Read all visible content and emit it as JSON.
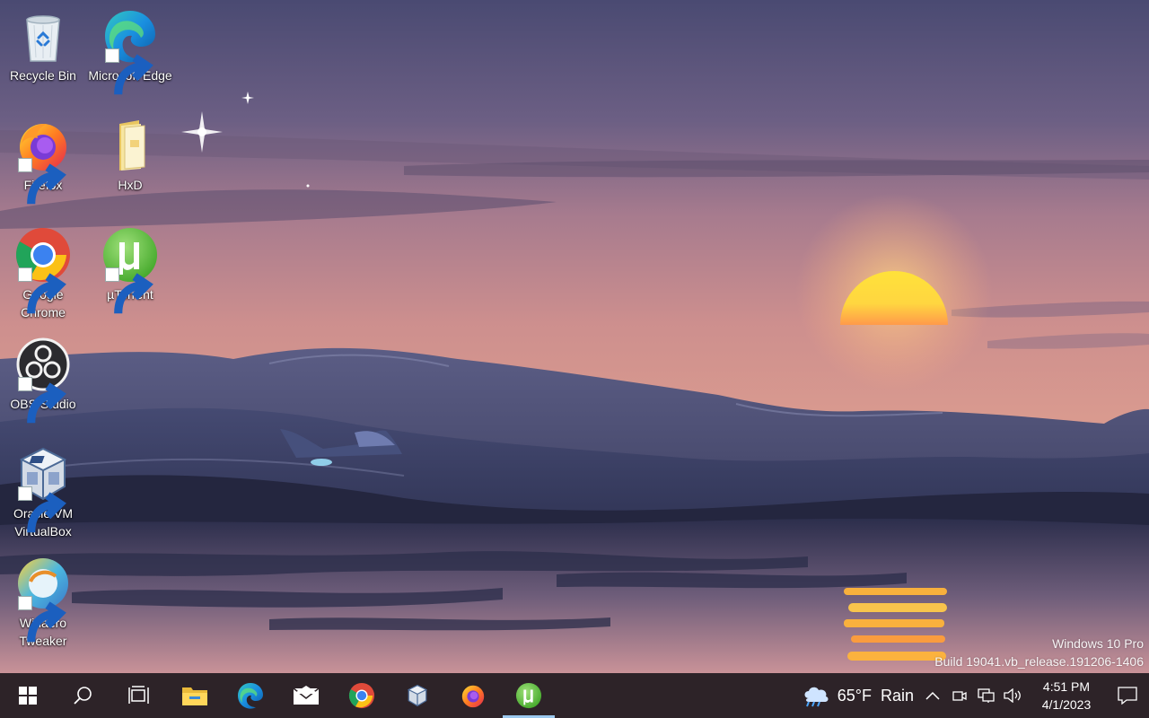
{
  "desktop": {
    "icons": [
      {
        "label": "Recycle Bin",
        "icon": "recycle-bin-icon"
      },
      {
        "label": "Microsoft Edge",
        "icon": "edge-icon"
      },
      {
        "label": "Firefox",
        "icon": "firefox-icon"
      },
      {
        "label": "HxD",
        "icon": "folder-icon"
      },
      {
        "label": "Google Chrome",
        "icon": "chrome-icon"
      },
      {
        "label": "µTorrent",
        "icon": "utorrent-icon"
      },
      {
        "label": "OBS Studio",
        "icon": "obs-icon"
      },
      {
        "label": "Oracle VM VirtualBox",
        "icon": "virtualbox-icon"
      },
      {
        "label": "Winaero Tweaker",
        "icon": "winaero-icon"
      }
    ]
  },
  "watermark": {
    "edition": "Windows 10 Pro",
    "build": "Build 19041.vb_release.191206-1406"
  },
  "taskbar": {
    "buttons": [
      {
        "name": "start",
        "icon": "windows-logo-icon"
      },
      {
        "name": "search",
        "icon": "search-icon"
      },
      {
        "name": "task-view",
        "icon": "task-view-icon"
      },
      {
        "name": "file-explorer",
        "icon": "folder-icon"
      },
      {
        "name": "edge",
        "icon": "edge-icon"
      },
      {
        "name": "mail",
        "icon": "mail-icon"
      },
      {
        "name": "chrome",
        "icon": "chrome-icon"
      },
      {
        "name": "virtualbox",
        "icon": "virtualbox-icon"
      },
      {
        "name": "firefox",
        "icon": "firefox-icon"
      },
      {
        "name": "utorrent",
        "icon": "utorrent-icon",
        "active": true
      }
    ],
    "weather": {
      "temp": "65°F",
      "condition": "Rain",
      "icon": "rain-cloud-icon"
    },
    "tray_icons": [
      "chevron-up-icon",
      "meet-now-icon",
      "network-icon",
      "volume-icon"
    ],
    "clock": {
      "time": "4:51 PM",
      "date": "4/1/2023"
    },
    "notification_icon": "action-center-icon"
  },
  "colors": {
    "taskbar": "#2d2328",
    "active_indicator": "#9bc8ee",
    "sky_top": "#4f5078",
    "sky_mid": "#c58a8f",
    "sun": "#ffd23a"
  }
}
